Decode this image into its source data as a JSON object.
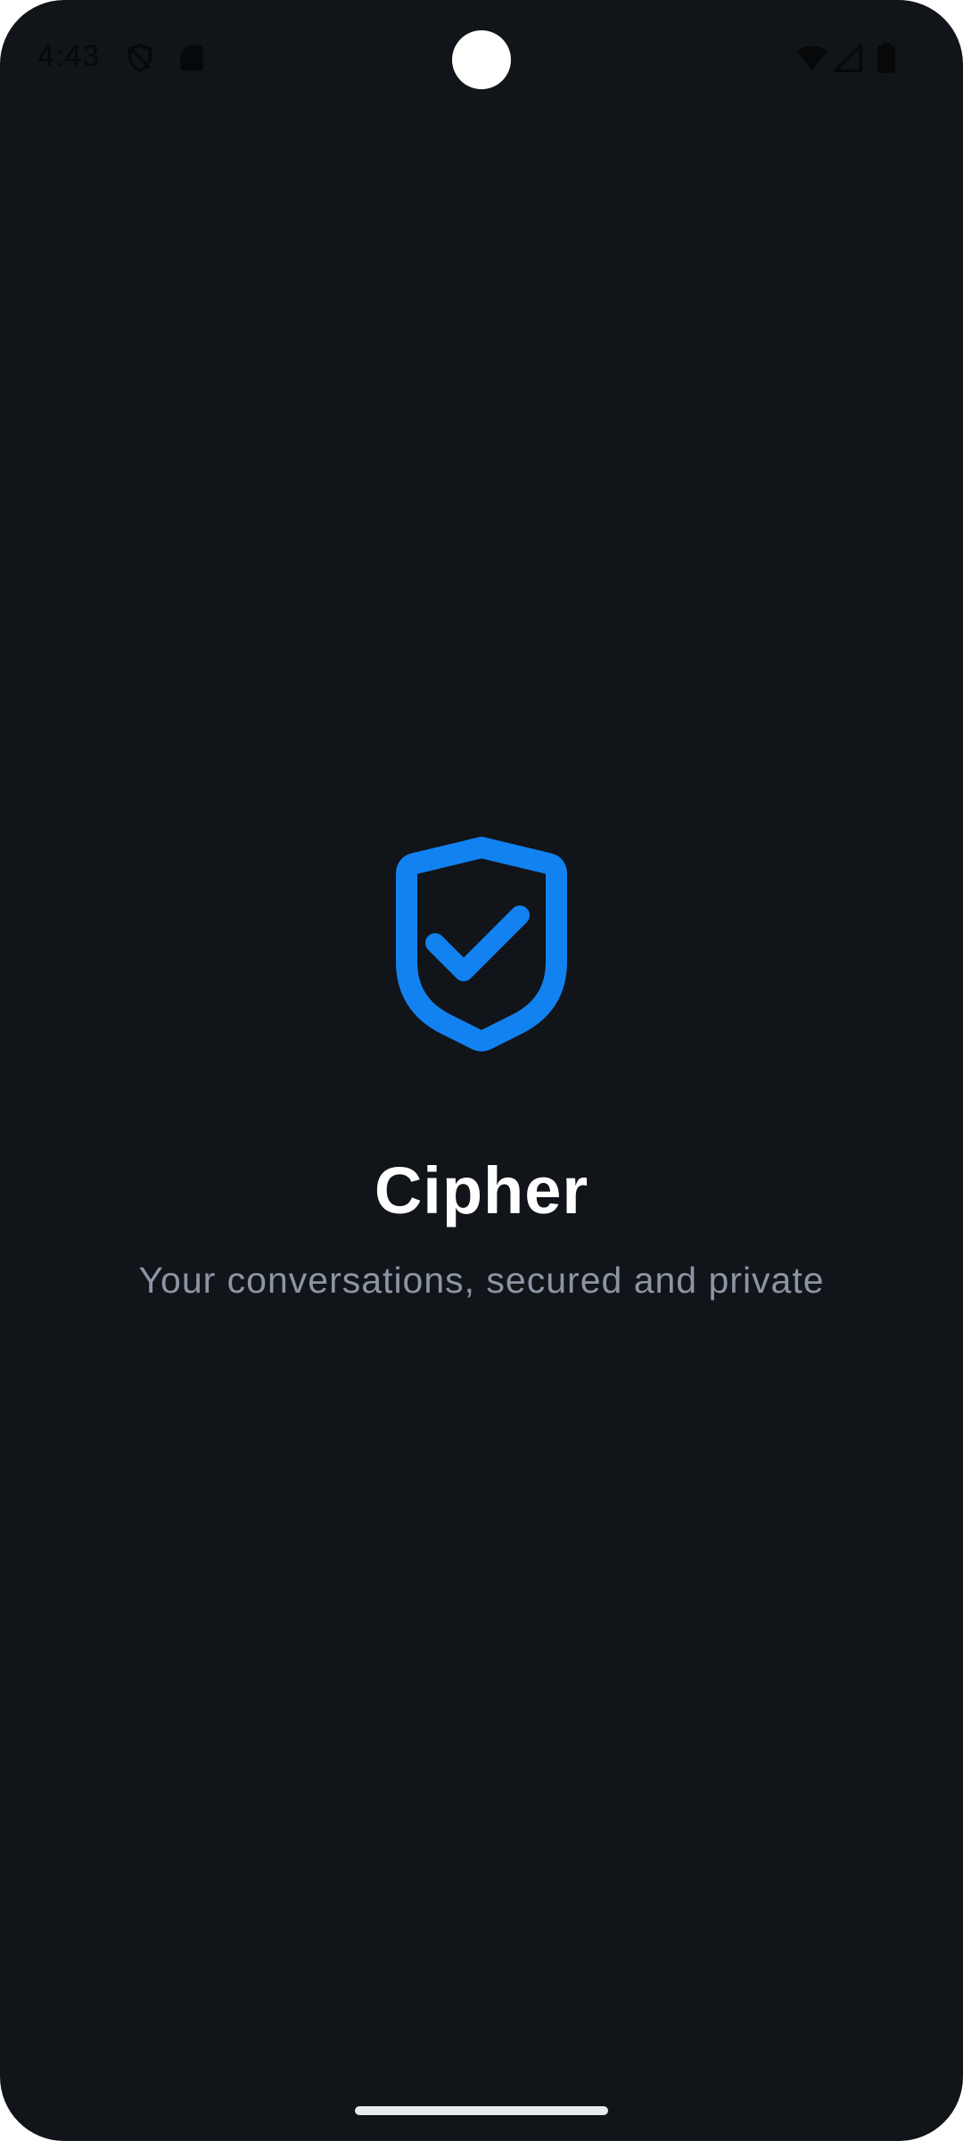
{
  "status_bar": {
    "time": "4:43",
    "left_icons": [
      "shield-off-icon",
      "sd-card-icon"
    ],
    "right_icons": [
      "wifi-icon",
      "cell-signal-icon",
      "battery-icon"
    ]
  },
  "splash": {
    "logo_icon": "shield-check-icon",
    "title": "Cipher",
    "tagline": "Your conversations, secured and private"
  },
  "colors": {
    "background": "#111419",
    "accent": "#1282f0",
    "title": "#ffffff",
    "tagline": "#8b95a3"
  }
}
